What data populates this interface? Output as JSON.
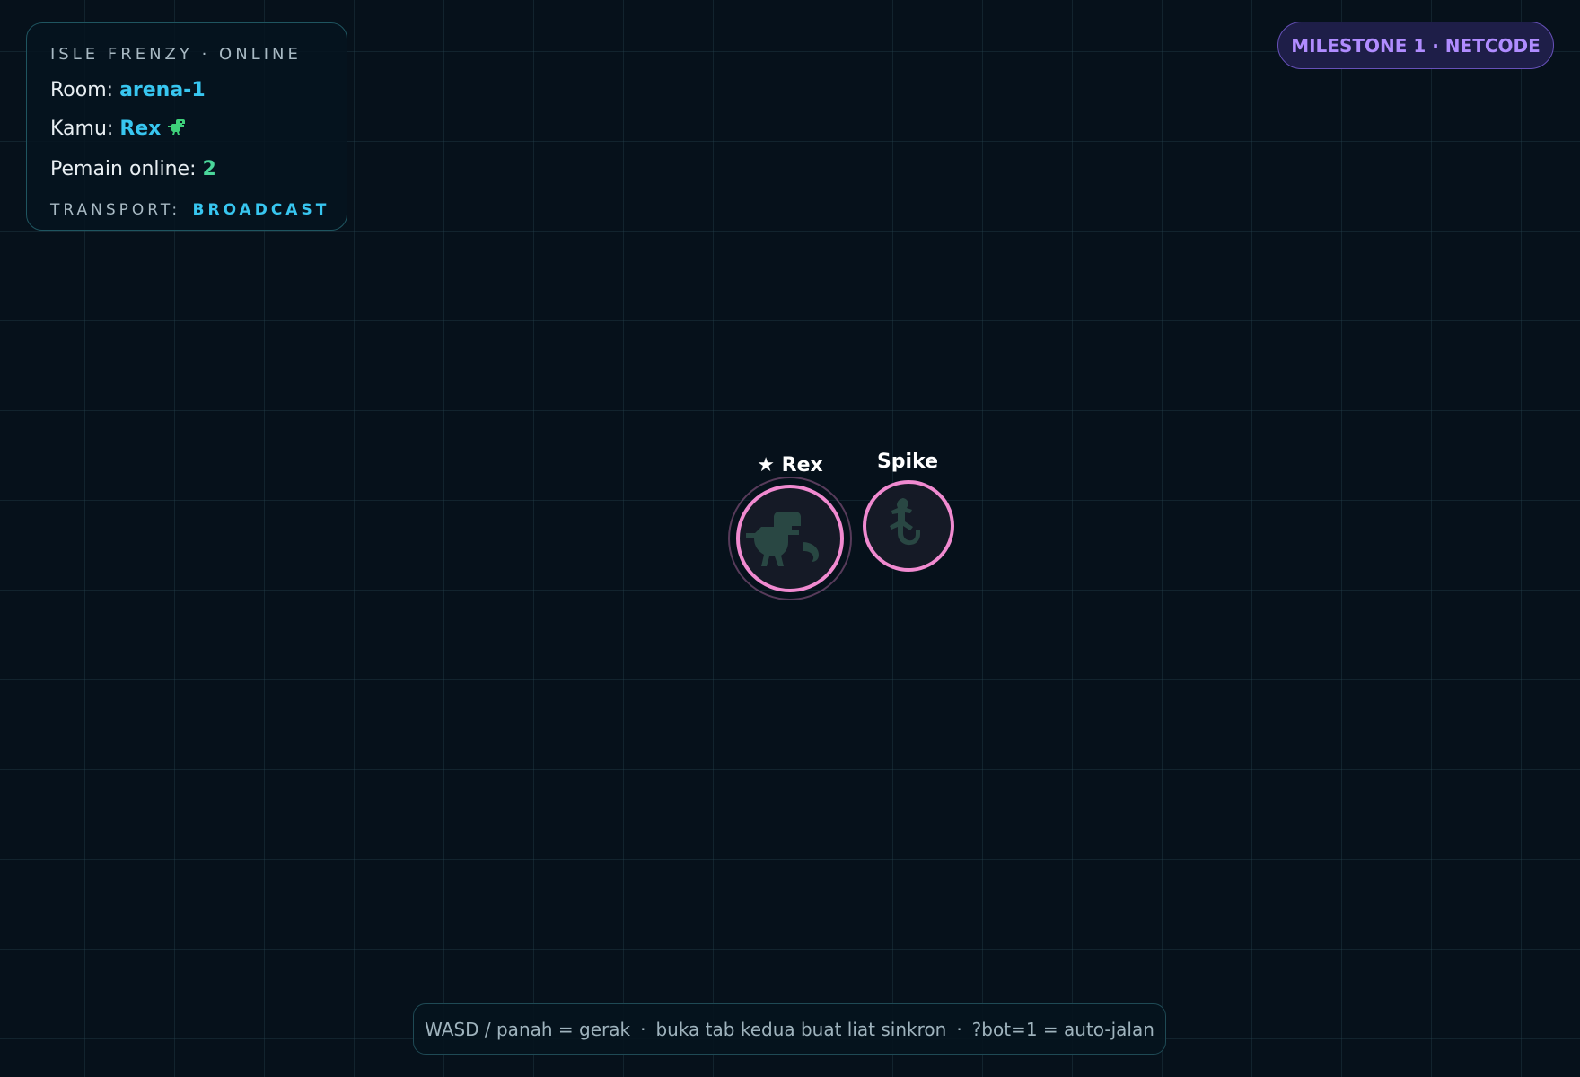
{
  "hud": {
    "title": "ISLE FRENZY · ONLINE",
    "room_label": "Room:",
    "room_value": "arena-1",
    "you_label": "Kamu:",
    "you_value": "Rex",
    "you_icon": "t-rex-icon",
    "online_label": "Pemain online:",
    "online_value": "2",
    "transport_label": "TRANSPORT:",
    "transport_value": "BROADCAST"
  },
  "badge": {
    "label": "MILESTONE 1 · NETCODE"
  },
  "players": [
    {
      "name": "★ Rex",
      "icon": "t-rex-icon",
      "is_self": true,
      "ring_color": "#f08ad0"
    },
    {
      "name": "Spike",
      "icon": "lizard-icon",
      "is_self": false,
      "ring_color": "#f08ad0"
    }
  ],
  "help": {
    "move": "WASD / panah = gerak",
    "sync": "buka tab kedua buat liat sinkron",
    "bot": "?bot=1 = auto-jalan",
    "separator": "·"
  },
  "colors": {
    "background": "#06111b",
    "accent_cyan": "#38c6f0",
    "accent_green": "#4ad69a",
    "accent_purple": "#b08cff",
    "player_ring": "#f08ad0"
  }
}
